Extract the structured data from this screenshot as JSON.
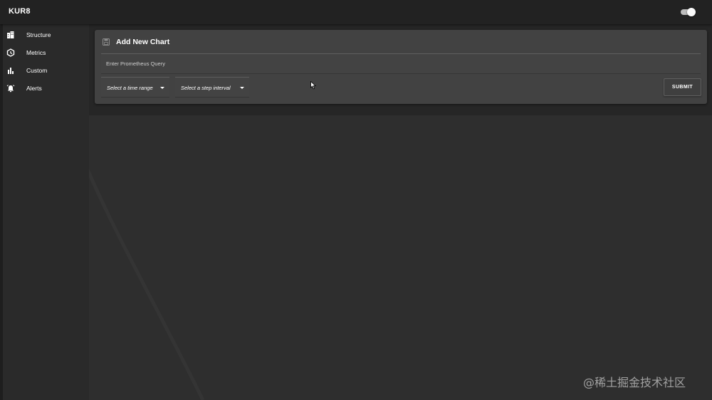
{
  "app": {
    "title": "KUR8"
  },
  "sidebar": {
    "items": [
      {
        "label": "Structure",
        "icon": "building-icon"
      },
      {
        "label": "Metrics",
        "icon": "hexagon-icon"
      },
      {
        "label": "Custom",
        "icon": "bar-chart-icon"
      },
      {
        "label": "Alerts",
        "icon": "alarm-icon"
      }
    ]
  },
  "card": {
    "title": "Add New Chart",
    "query_placeholder": "Enter Prometheus Query",
    "time_range_label": "Select a time range",
    "step_interval_label": "Select a step interval",
    "submit_label": "SUBMIT"
  },
  "watermark": "@稀土掘金技术社区",
  "colors": {
    "app_bar": "#222222",
    "background": "#2e2e2e",
    "card": "#424242",
    "text": "#ffffff"
  }
}
